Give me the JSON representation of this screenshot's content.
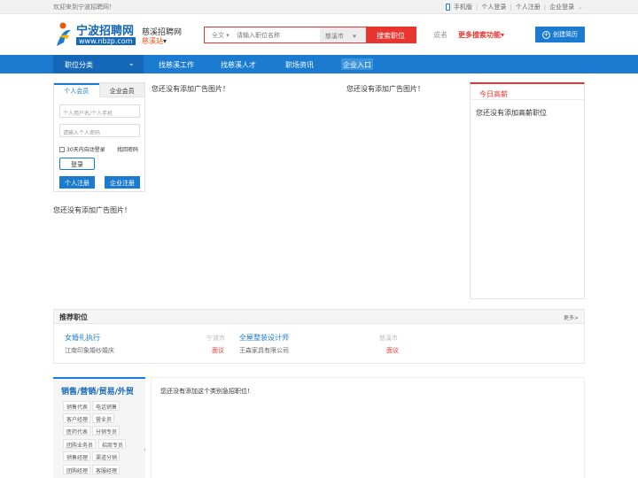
{
  "topbar": {
    "welcome": "欢迎来到宁波招聘网！",
    "mobile": "手机版",
    "personal_login": "个人登录",
    "personal_register": "个人注册",
    "company_login": "企业登录"
  },
  "header": {
    "logo_main": "宁波招聘网",
    "logo_url": "www.nbzp.com",
    "city_title": "慈溪招聘网",
    "city_switch": "慈溪站",
    "search_type": "全文",
    "search_placeholder": "请输入职位名称",
    "search_city": "慈溪市",
    "search_button": "搜索职位",
    "or_text": "或者",
    "more_search": "更多搜索功能",
    "create_resume": "创建简历"
  },
  "nav": {
    "category": "职位分类",
    "items": [
      "找慈溪工作",
      "找慈溪人才",
      "职场资讯"
    ],
    "company_entry": "企业入口"
  },
  "login": {
    "tab_personal": "个人会员",
    "tab_company": "企业会员",
    "username_placeholder": "个人用户名/个人手机",
    "password_placeholder": "请输入个人密码",
    "remember": "30天内自动登录",
    "forgot": "找回密码",
    "login_button": "登录",
    "personal_register": "个人注册",
    "company_register": "企业注册"
  },
  "ads": {
    "no_ad_1": "您还没有添加广告图片！",
    "no_ad_2": "您还没有添加广告图片！",
    "no_ad_3": "您还没有添加广告图片！"
  },
  "today": {
    "title": "今日高薪",
    "empty": "您还没有添加高薪职位"
  },
  "recommend": {
    "title": "推荐职位",
    "more": "更多>",
    "jobs": [
      {
        "name": "女婚礼执行",
        "city": "宁波市",
        "company": "江南印象婚纱婚庆",
        "salary": "面议"
      },
      {
        "name": "全屋整装设计师",
        "city": "慈溪市",
        "company": "王森家具有限公司",
        "salary": "面议"
      }
    ]
  },
  "category_block": {
    "title": "销售/营销/贸易/外贸",
    "chips": [
      [
        "销售代表",
        "电话销售"
      ],
      [
        "客户经理",
        "营业员"
      ],
      [
        "医药代表",
        "分销专员"
      ],
      [
        "团购业务员",
        "招商专员"
      ],
      [
        "销售经理",
        "渠道分销"
      ],
      [
        "团购经理",
        "客服经理"
      ]
    ],
    "empty": "您还没有添加这个类别急招职位!"
  },
  "colors": {
    "primary_blue": "#1a7bd0",
    "accent_red": "#e8352f",
    "orange": "#e8560f"
  }
}
